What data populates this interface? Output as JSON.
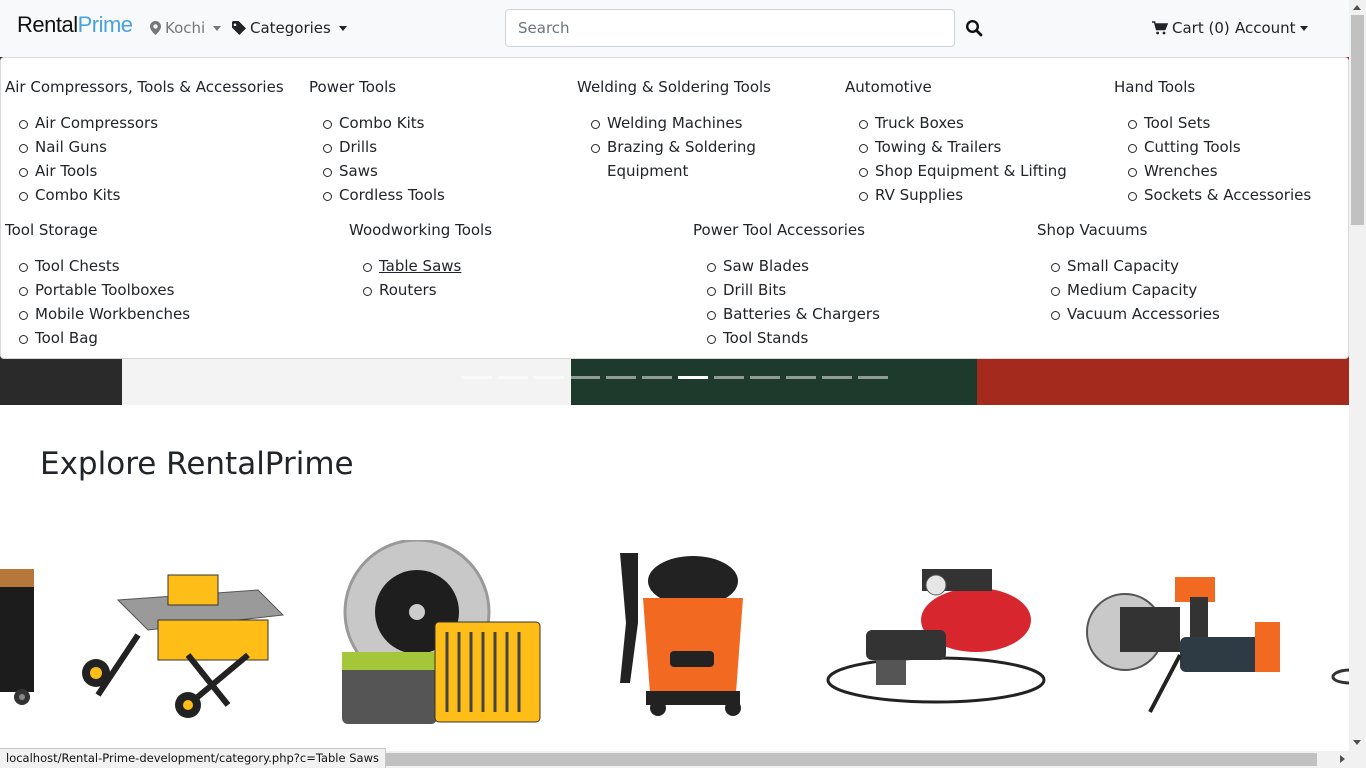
{
  "navbar": {
    "logo_rental": "Rental",
    "logo_prime": "Prime",
    "location": "Kochi",
    "categories_label": "Categories",
    "search_placeholder": "Search",
    "cart_label": "Cart (0)",
    "account_label": "Account"
  },
  "mega_menu": {
    "row1": [
      {
        "title": "Air Compressors, Tools & Accessories",
        "items": [
          "Air Compressors",
          "Nail Guns",
          "Air Tools",
          "Combo Kits"
        ]
      },
      {
        "title": "Power Tools",
        "items": [
          "Combo Kits",
          "Drills",
          "Saws",
          "Cordless Tools"
        ]
      },
      {
        "title": "Welding & Soldering Tools",
        "items": [
          "Welding Machines",
          "Brazing & Soldering Equipment"
        ]
      },
      {
        "title": "Automotive",
        "items": [
          "Truck Boxes",
          "Towing & Trailers",
          "Shop Equipment & Lifting",
          "RV Supplies"
        ]
      },
      {
        "title": "Hand Tools",
        "items": [
          "Tool Sets",
          "Cutting Tools",
          "Wrenches",
          "Sockets & Accessories"
        ]
      }
    ],
    "row2": [
      {
        "title": "Tool Storage",
        "items": [
          "Tool Chests",
          "Portable Toolboxes",
          "Mobile Workbenches",
          "Tool Bag"
        ]
      },
      {
        "title": "Woodworking Tools",
        "items": [
          "Table Saws",
          "Routers"
        ]
      },
      {
        "title": "Power Tool Accessories",
        "items": [
          "Saw Blades",
          "Drill Bits",
          "Batteries & Chargers",
          "Tool Stands"
        ]
      },
      {
        "title": "Shop Vacuums",
        "items": [
          "Small Capacity",
          "Medium Capacity",
          "Vacuum Accessories"
        ]
      }
    ]
  },
  "carousel": {
    "indicator_count": 12,
    "active_index": 6
  },
  "explore": {
    "title": "Explore RentalPrime"
  },
  "status_url": "localhost/Rental-Prime-development/category.php?c=Table Saws",
  "colors": {
    "brand_blue": "#4aa3df",
    "navbar_bg": "#f8f9fa",
    "text": "#212529",
    "ridgid_orange": "#f26a21",
    "dewalt_yellow": "#febd17"
  }
}
